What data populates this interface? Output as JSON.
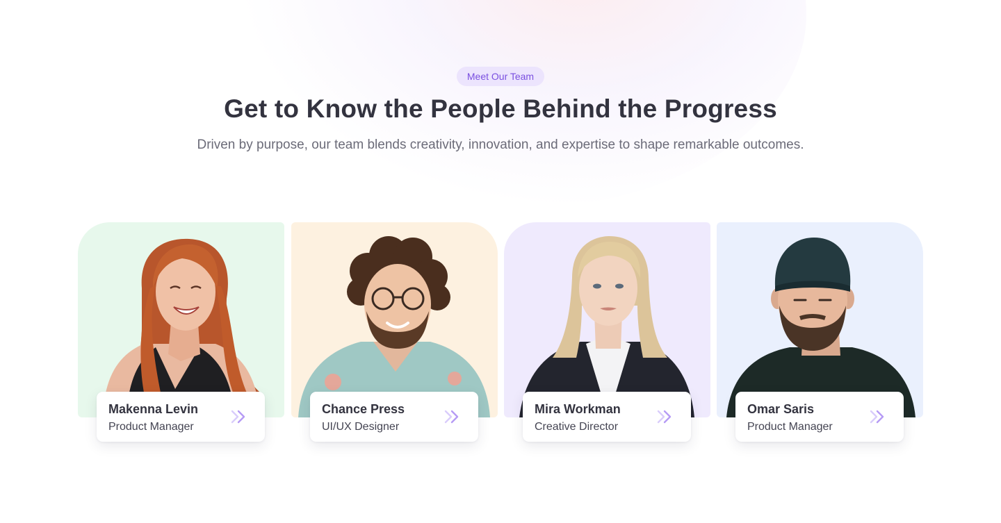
{
  "header": {
    "badge": "Meet Our Team",
    "title": "Get to Know the People Behind the Progress",
    "subtitle": "Driven by purpose, our team blends creativity, innovation, and expertise to shape remarkable outcomes."
  },
  "colors": {
    "accent": "#7a4fe0",
    "badge_bg": "#ece4fd",
    "arrow": "#b69bf5"
  },
  "team": [
    {
      "name": "Makenna Levin",
      "role": "Product Manager",
      "bg": "#e7f8ec",
      "icon": "chevron-double-right-icon"
    },
    {
      "name": "Chance Press",
      "role": "UI/UX Designer",
      "bg": "#fdf1e0",
      "icon": "chevron-double-right-icon"
    },
    {
      "name": "Mira Workman",
      "role": "Creative Director",
      "bg": "#efeafd",
      "icon": "chevron-double-right-icon"
    },
    {
      "name": "Omar Saris",
      "role": "Product Manager",
      "bg": "#eaf0fd",
      "icon": "chevron-double-right-icon"
    }
  ]
}
